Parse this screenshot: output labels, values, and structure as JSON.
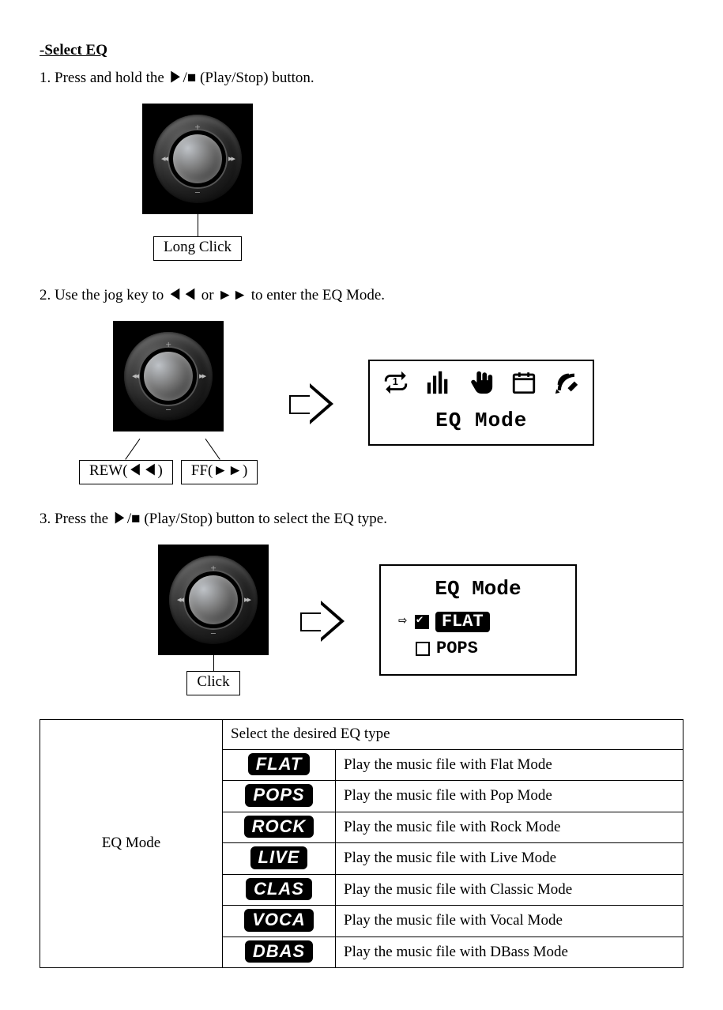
{
  "title": "-Select EQ",
  "steps": {
    "s1": "1. Press and hold the ▶/■ (Play/Stop) button.",
    "s2": "2. Use the jog key to ◀◀ or ►► to enter the EQ Mode.",
    "s3": "3. Press the ▶/■ (Play/Stop) button to select the EQ type."
  },
  "callouts": {
    "long_click": "Long Click",
    "rew": "REW(◀◀)",
    "ff": "FF(►►)",
    "click": "Click"
  },
  "lcd1": {
    "label": "EQ Mode"
  },
  "lcd2": {
    "title": "EQ Mode",
    "opt_selected": "FLAT",
    "opt_other": "POPS"
  },
  "table": {
    "mode_label": "EQ Mode",
    "select_header": "Select the desired EQ type",
    "rows": [
      {
        "badge": "FLAT",
        "desc": "Play the music file with Flat Mode"
      },
      {
        "badge": "POPS",
        "desc": "Play the music file with Pop Mode"
      },
      {
        "badge": "ROCK",
        "desc": "Play the music file with Rock Mode"
      },
      {
        "badge": "LIVE",
        "desc": "Play the music file with Live Mode"
      },
      {
        "badge": "CLAS",
        "desc": "Play the music file with Classic Mode"
      },
      {
        "badge": "VOCA",
        "desc": "Play the music file with Vocal Mode"
      },
      {
        "badge": "DBAS",
        "desc": "Play the music file with DBass Mode"
      }
    ]
  }
}
